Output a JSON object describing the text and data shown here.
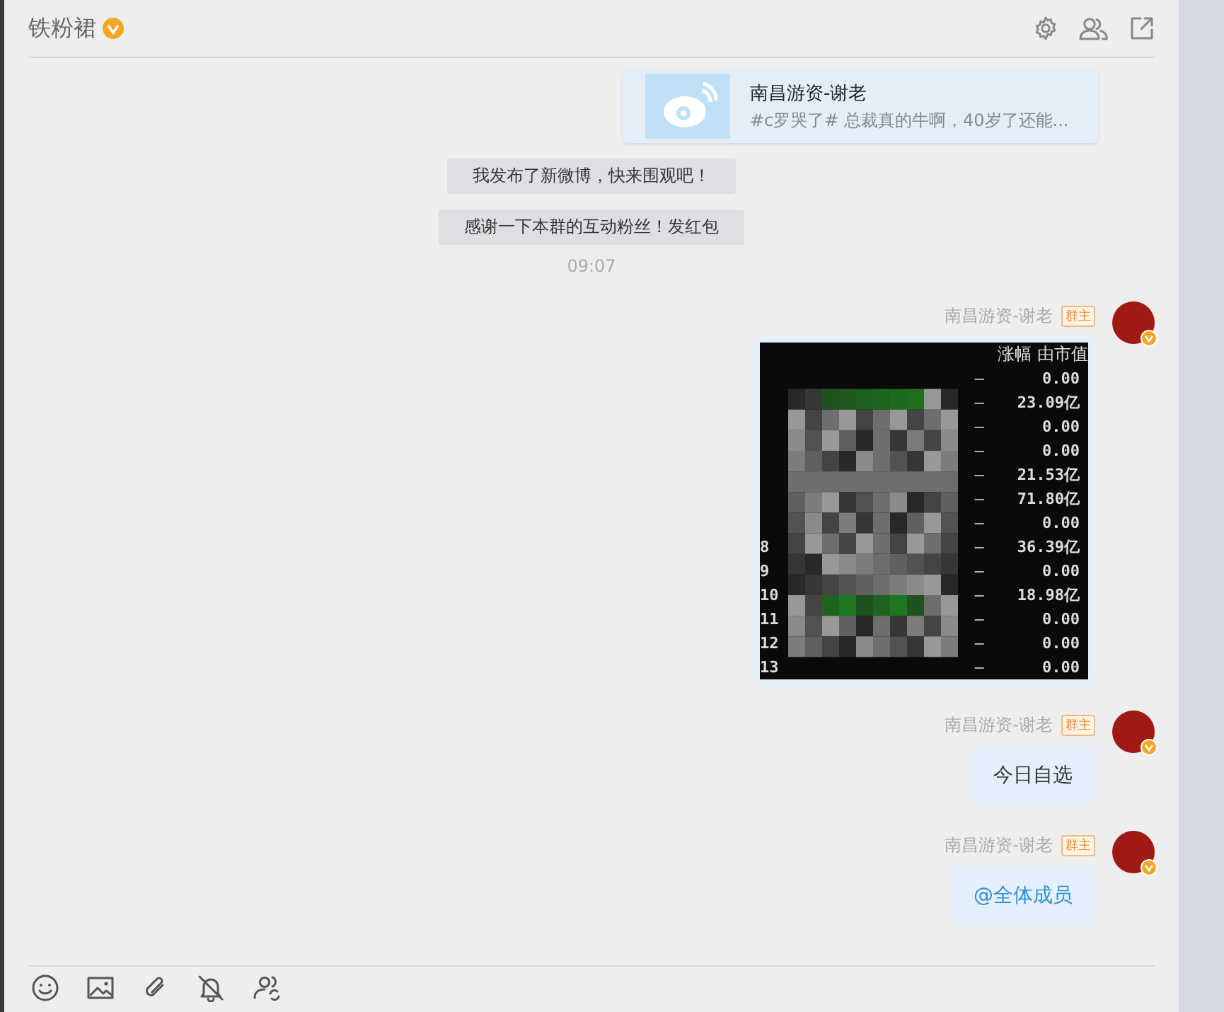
{
  "header": {
    "title": "铁粉裙",
    "verified": true
  },
  "messages": [
    {
      "kind": "share_card",
      "title": "南昌游资-谢老",
      "text": "#c罗哭了# 总裁真的牛啊，40岁了还能..."
    },
    {
      "kind": "system",
      "text": "我发布了新微博，快来围观吧！"
    },
    {
      "kind": "system",
      "text": "感谢一下本群的互动粉丝！发红包"
    },
    {
      "kind": "time",
      "text": "09:07"
    },
    {
      "kind": "image",
      "sender": "南昌游资-谢老",
      "role": "群主",
      "table": {
        "columns": [
          "涨幅",
          "由市值"
        ],
        "rows": [
          {
            "index": "",
            "change": "–",
            "cap": "0.00"
          },
          {
            "index": "",
            "change": "–",
            "cap": "23.09亿"
          },
          {
            "index": "",
            "change": "–",
            "cap": "0.00"
          },
          {
            "index": "",
            "change": "–",
            "cap": "0.00"
          },
          {
            "index": "",
            "change": "–",
            "cap": "21.53亿"
          },
          {
            "index": "",
            "change": "–",
            "cap": "71.80亿"
          },
          {
            "index": "",
            "change": "–",
            "cap": "0.00"
          },
          {
            "index": "8",
            "change": "–",
            "cap": "36.39亿"
          },
          {
            "index": "9",
            "change": "–",
            "cap": "0.00"
          },
          {
            "index": "10",
            "change": "–",
            "cap": "18.98亿"
          },
          {
            "index": "11",
            "change": "–",
            "cap": "0.00"
          },
          {
            "index": "12",
            "change": "–",
            "cap": "0.00"
          },
          {
            "index": "13",
            "change": "–",
            "cap": "0.00"
          }
        ]
      }
    },
    {
      "kind": "text",
      "sender": "南昌游资-谢老",
      "role": "群主",
      "text": "今日自选",
      "mention": false
    },
    {
      "kind": "text",
      "sender": "南昌游资-谢老",
      "role": "群主",
      "text": "@全体成员",
      "mention": true
    }
  ]
}
